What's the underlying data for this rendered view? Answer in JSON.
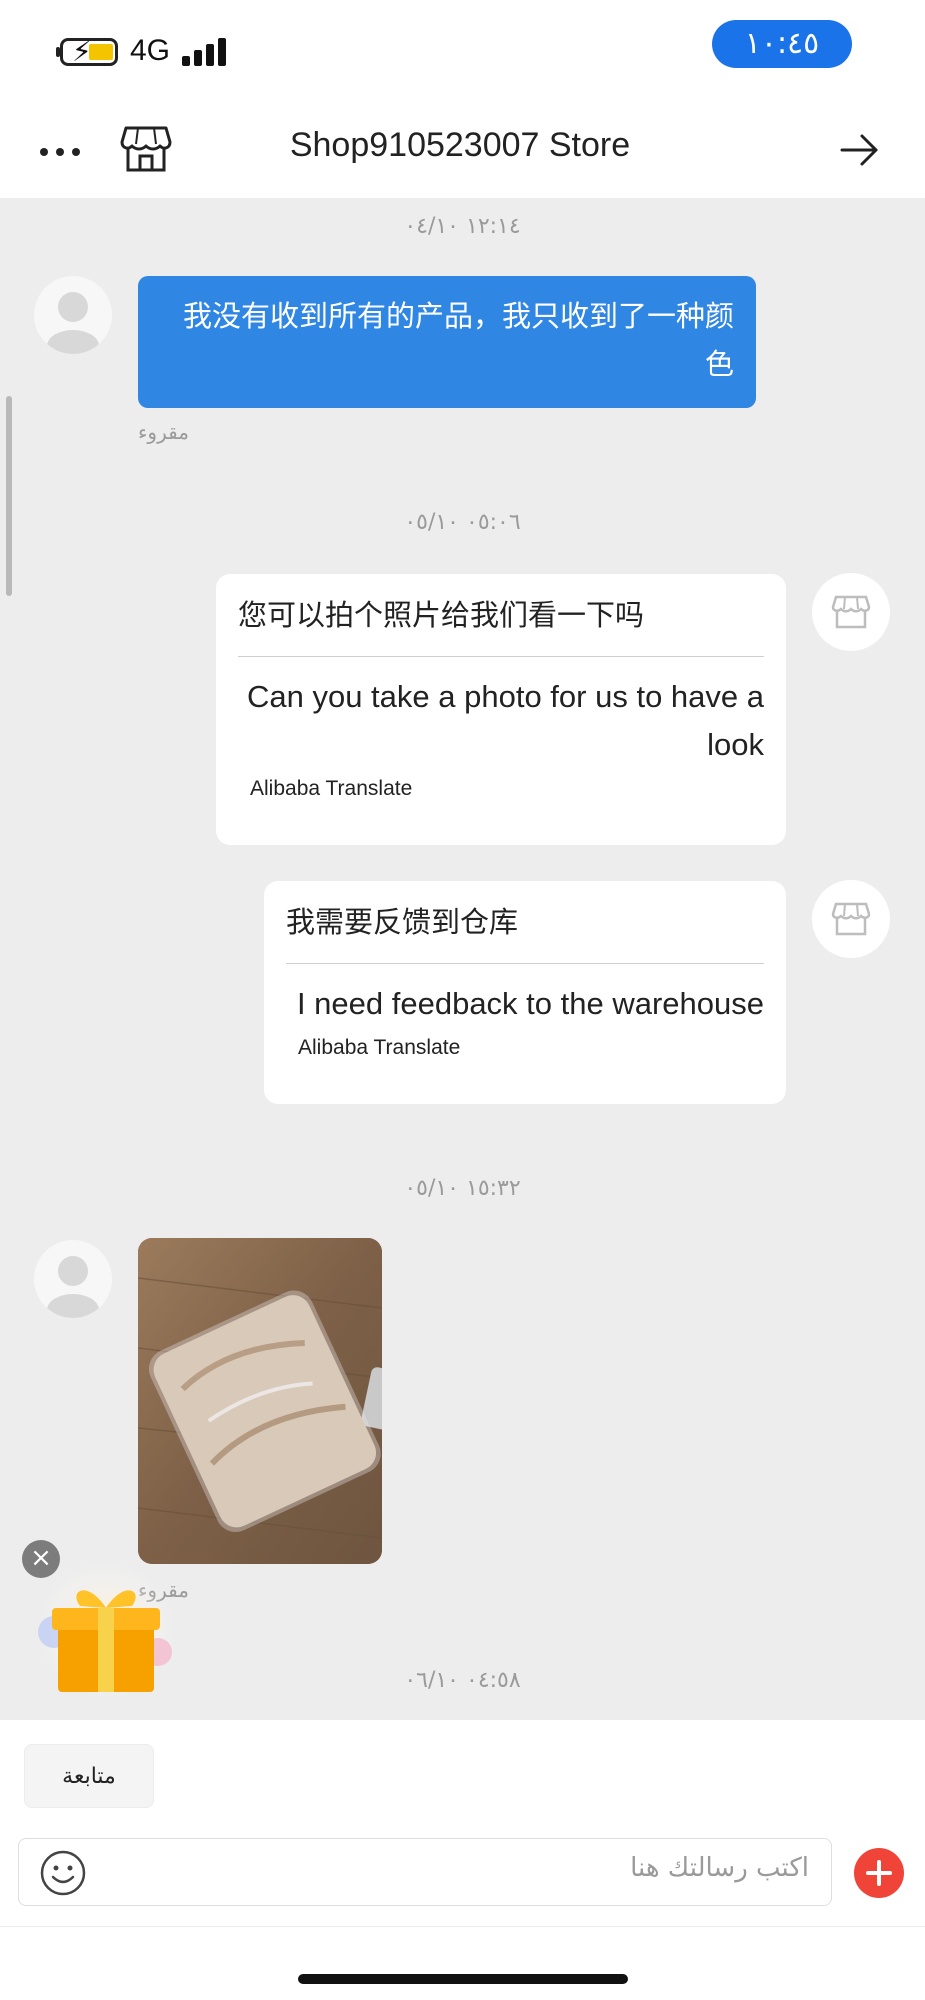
{
  "status_bar": {
    "network": "4G",
    "time": "١٠:٤٥",
    "accent_color": "#1a73e8"
  },
  "header": {
    "title": "Shop910523007 Store",
    "icons": [
      "more-icon",
      "store-icon",
      "arrow-right-icon"
    ]
  },
  "chat": {
    "messages": [
      {
        "timestamp": "١٢:١٤ ٠٤/١٠",
        "side": "me",
        "text": "我没有收到所有的产品，我只收到了一种颜色",
        "status": "مقروء"
      },
      {
        "timestamp": "٠٥:٠٦ ٠٥/١٠",
        "side": "shop",
        "original": "您可以拍个照片给我们看一下吗",
        "translation": "Can you take a photo for us to have a look",
        "translator": "Alibaba Translate"
      },
      {
        "side": "shop",
        "original": "我需要反馈到仓库",
        "translation": "I need feedback to the warehouse",
        "translator": "Alibaba Translate"
      },
      {
        "timestamp": "١٥:٣٢ ٠٥/١٠",
        "side": "me",
        "type": "image",
        "image_desc": "photo-of-packaged-clothing",
        "status": "مقروء"
      },
      {
        "timestamp": "٠٤:٥٨ ٠٦/١٠"
      }
    ]
  },
  "bottom_bar": {
    "follow_label": "متابعة",
    "input_placeholder": "اكتب رسالتك هنا",
    "send_accent": "#f04438"
  }
}
